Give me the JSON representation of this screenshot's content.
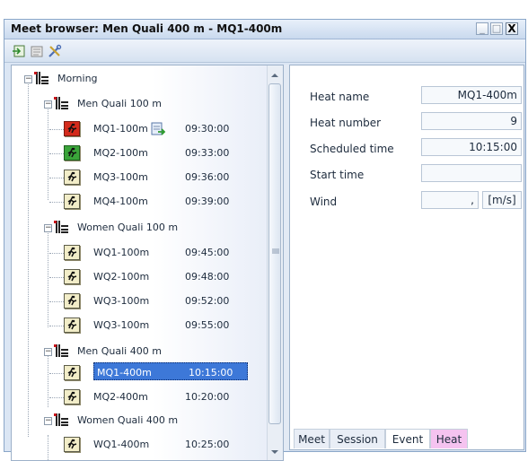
{
  "window": {
    "title": "Meet browser: Men Quali 400 m - MQ1-400m",
    "buttons": {
      "minimize": "_",
      "maximize": "□",
      "close": "X"
    }
  },
  "toolbar": {
    "icons": [
      "import-icon",
      "edit-icon",
      "tools-icon"
    ]
  },
  "tree": {
    "session": {
      "label": "Morning",
      "expander": "−"
    },
    "events": [
      {
        "label": "Men Quali 100 m",
        "expander": "−",
        "heats": [
          {
            "label": "MQ1-100m",
            "time": "09:30:00",
            "status": "red"
          },
          {
            "label": "MQ2-100m",
            "time": "09:33:00",
            "status": "green"
          },
          {
            "label": "MQ3-100m",
            "time": "09:36:00",
            "status": "none"
          },
          {
            "label": "MQ4-100m",
            "time": "09:39:00",
            "status": "none"
          }
        ]
      },
      {
        "label": "Women Quali 100 m",
        "expander": "−",
        "heats": [
          {
            "label": "WQ1-100m",
            "time": "09:45:00",
            "status": "none"
          },
          {
            "label": "WQ2-100m",
            "time": "09:48:00",
            "status": "none"
          },
          {
            "label": "WQ3-100m",
            "time": "09:52:00",
            "status": "none"
          },
          {
            "label": "WQ3-100m",
            "time": "09:55:00",
            "status": "none"
          }
        ]
      },
      {
        "label": "Men Quali 400 m",
        "expander": "−",
        "heats": [
          {
            "label": "MQ1-400m",
            "time": "10:15:00",
            "status": "none",
            "selected": true
          },
          {
            "label": "MQ2-400m",
            "time": "10:20:00",
            "status": "none"
          }
        ]
      },
      {
        "label": "Women Quali 400 m",
        "expander": "−",
        "heats": [
          {
            "label": "WQ1-400m",
            "time": "10:25:00",
            "status": "none"
          }
        ]
      }
    ]
  },
  "details": {
    "heat_name": {
      "label": "Heat name",
      "value": "MQ1-400m"
    },
    "heat_number": {
      "label": "Heat number",
      "value": "9"
    },
    "scheduled_time": {
      "label": "Scheduled time",
      "value": "10:15:00"
    },
    "start_time": {
      "label": "Start time",
      "value": ""
    },
    "wind": {
      "label": "Wind",
      "value": ",",
      "unit": "[m/s]"
    }
  },
  "tabs": [
    "Meet",
    "Session",
    "Event",
    "Heat"
  ],
  "active_tab": "Heat",
  "colors": {
    "selection": "#3d78d8",
    "heat_tab": "#f5c3f0",
    "status_red": "#d42b1c",
    "status_green": "#3aa43a"
  }
}
